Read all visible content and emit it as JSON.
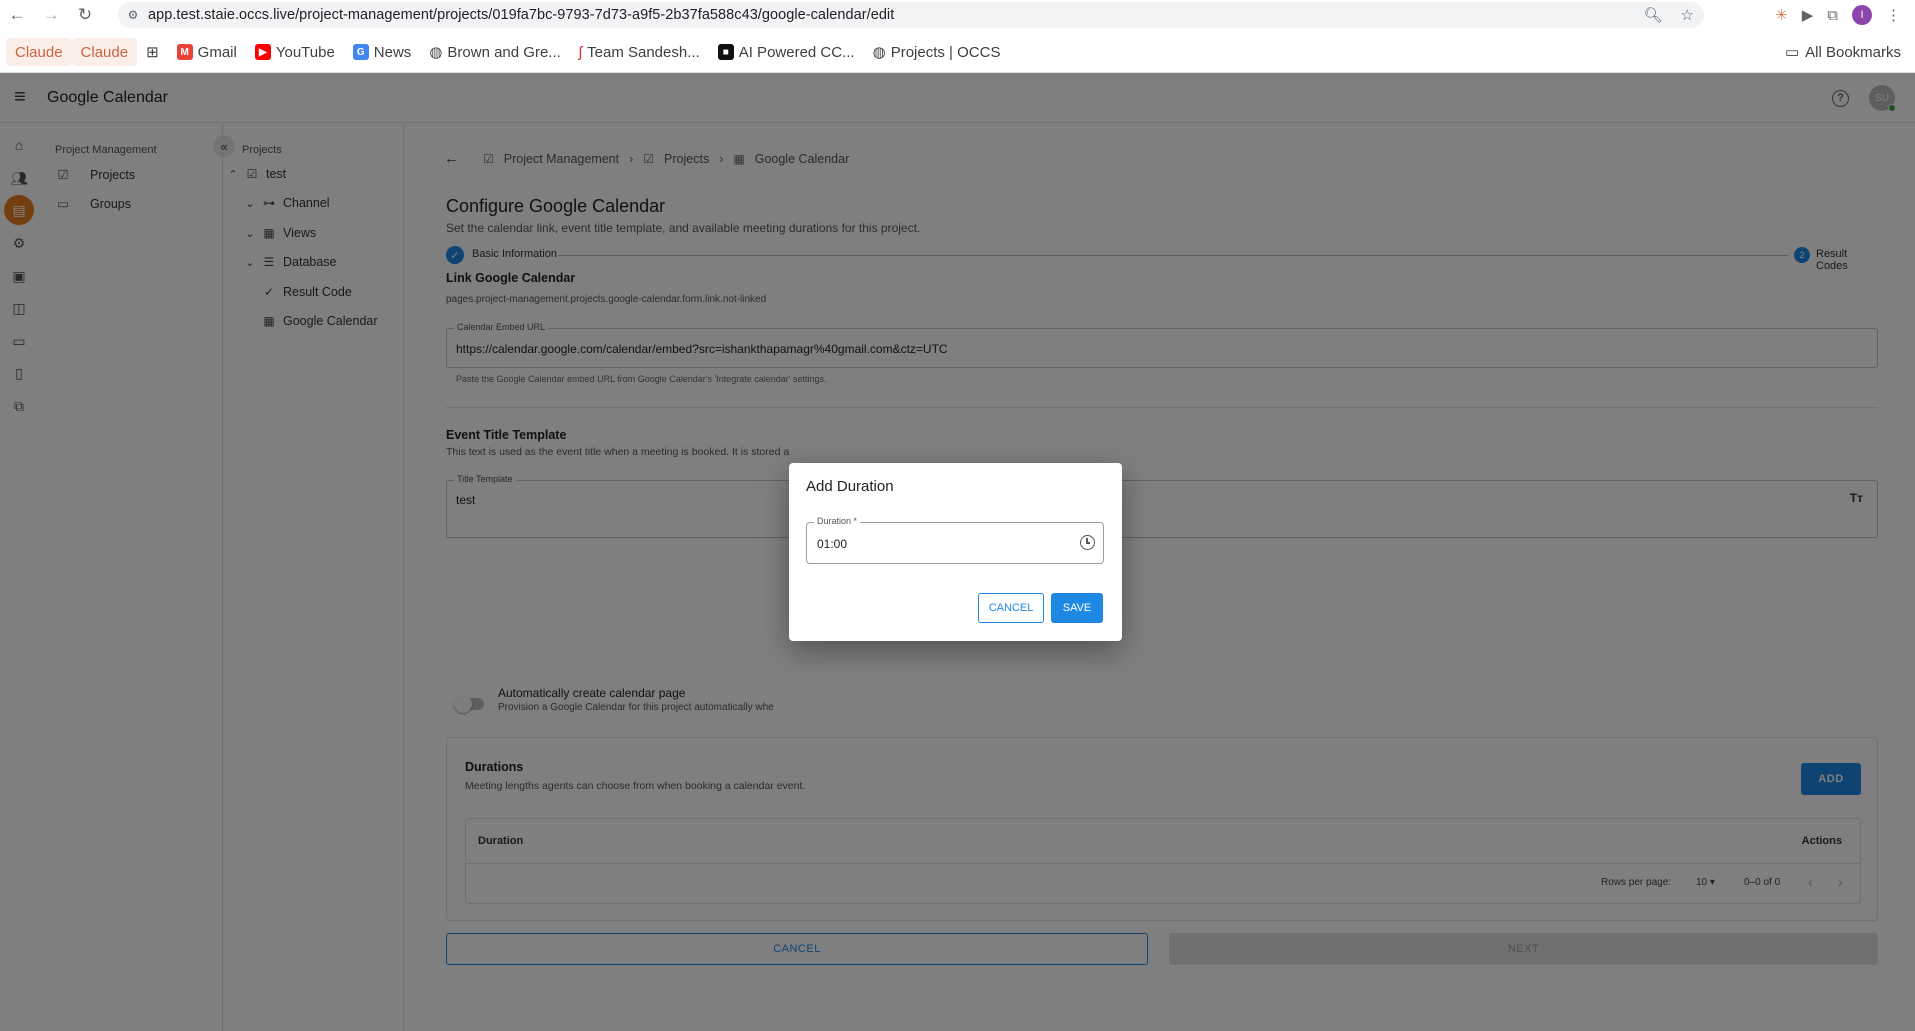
{
  "browser": {
    "url": "app.test.staie.occs.live/project-management/projects/019fa7bc-9793-7d73-a9f5-2b37fa588c43/google-calendar/edit",
    "profile_initial": "I",
    "bookmarks": [
      {
        "label": "Claude"
      },
      {
        "label": "Claude"
      },
      {
        "label": "Gmail"
      },
      {
        "label": "YouTube"
      },
      {
        "label": "News"
      },
      {
        "label": "Brown and Gre..."
      },
      {
        "label": "Team Sandesh..."
      },
      {
        "label": "AI Powered CC..."
      },
      {
        "label": "Projects | OCCS"
      }
    ],
    "all_bookmarks": "All Bookmarks"
  },
  "app": {
    "title": "Google Calendar",
    "avatar_initials": "SU"
  },
  "pm_nav": {
    "heading": "Project Management",
    "items": [
      {
        "label": "Projects",
        "icon": "checkbox-icon"
      },
      {
        "label": "Groups",
        "icon": "folder-icon"
      }
    ]
  },
  "tree": {
    "heading": "Projects",
    "items": [
      {
        "label": "test"
      },
      {
        "label": "Channel"
      },
      {
        "label": "Views"
      },
      {
        "label": "Database"
      },
      {
        "label": "Result Code"
      },
      {
        "label": "Google Calendar"
      }
    ]
  },
  "breadcrumb": {
    "items": [
      {
        "label": "Project Management"
      },
      {
        "label": "Projects"
      },
      {
        "label": "Google Calendar"
      }
    ]
  },
  "page": {
    "title": "Configure Google Calendar",
    "subtitle": "Set the calendar link, event title template, and available meeting durations for this project."
  },
  "stepper": {
    "step1": "Basic Information",
    "step2_number": "2",
    "step2": "Result Codes"
  },
  "link_section": {
    "title": "Link Google Calendar",
    "status": "pages.project-management.projects.google-calendar.form.link.not-linked",
    "field_label": "Calendar Embed URL",
    "field_value": "https://calendar.google.com/calendar/embed?src=ishankthapamagr%40gmail.com&ctz=UTC",
    "helper": "Paste the Google Calendar embed URL from Google Calendar's 'Integrate calendar' settings."
  },
  "title_section": {
    "title": "Event Title Template",
    "description": "This text is used as the event title when a meeting is booked. It is stored a",
    "field_label": "Title Template",
    "field_value": "test"
  },
  "auto_create": {
    "label": "Automatically create calendar page",
    "description": "Provision a Google Calendar for this project automatically whe"
  },
  "durations": {
    "title": "Durations",
    "description": "Meeting lengths agents can choose from when booking a calendar event.",
    "add_label": "ADD",
    "col_duration": "Duration",
    "col_actions": "Actions",
    "rows_per_page_label": "Rows per page:",
    "rows_per_page_value": "10",
    "range": "0–0 of 0"
  },
  "actions": {
    "cancel": "CANCEL",
    "next": "NEXT"
  },
  "dialog": {
    "title": "Add Duration",
    "field_label": "Duration *",
    "field_value": "01:00",
    "cancel": "CANCEL",
    "save": "SAVE"
  },
  "colors": {
    "primary": "#1e88e5",
    "rail_active": "#e67e22"
  }
}
